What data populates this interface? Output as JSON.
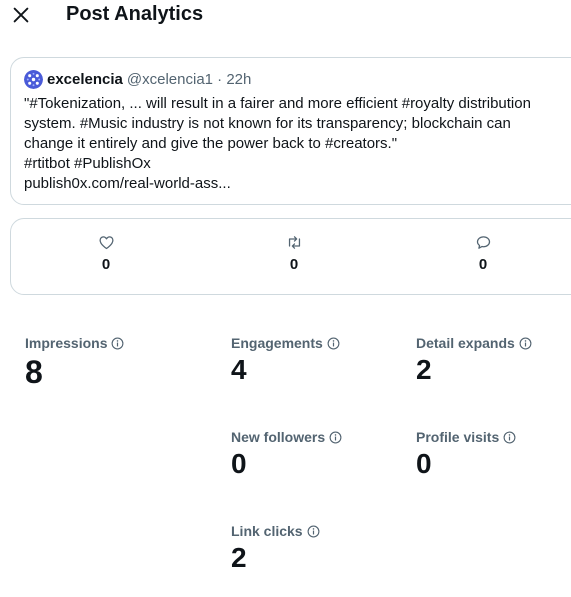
{
  "header": {
    "title": "Post Analytics",
    "close_icon": "close-icon"
  },
  "post": {
    "author_name": "excelencia",
    "author_handle": "@xcelencia1 · 22h",
    "lines": [
      "\"#Tokenization, ... will result in a fairer and more efficient #royalty distribution",
      "system. #Music industry is not known for its transparency; blockchain can",
      "change it entirely and give the power back to #creators.\"",
      "#rtitbot #PublishOx",
      "publish0x.com/real-world-ass..."
    ]
  },
  "actions": {
    "likes": {
      "icon": "heart-icon",
      "count": "0"
    },
    "reposts": {
      "icon": "repost-icon",
      "count": "0"
    },
    "replies": {
      "icon": "reply-icon",
      "count": "0"
    }
  },
  "metrics": {
    "impressions": {
      "label": "Impressions",
      "value": "8"
    },
    "engagements": {
      "label": "Engagements",
      "value": "4"
    },
    "detail_expands": {
      "label": "Detail expands",
      "value": "2"
    },
    "new_followers": {
      "label": "New followers",
      "value": "0"
    },
    "profile_visits": {
      "label": "Profile visits",
      "value": "0"
    },
    "link_clicks": {
      "label": "Link clicks",
      "value": "2"
    }
  },
  "colors": {
    "text": "#0f1419",
    "muted": "#536471",
    "border": "#cfd9de",
    "avatar": "#4a5bd8"
  }
}
